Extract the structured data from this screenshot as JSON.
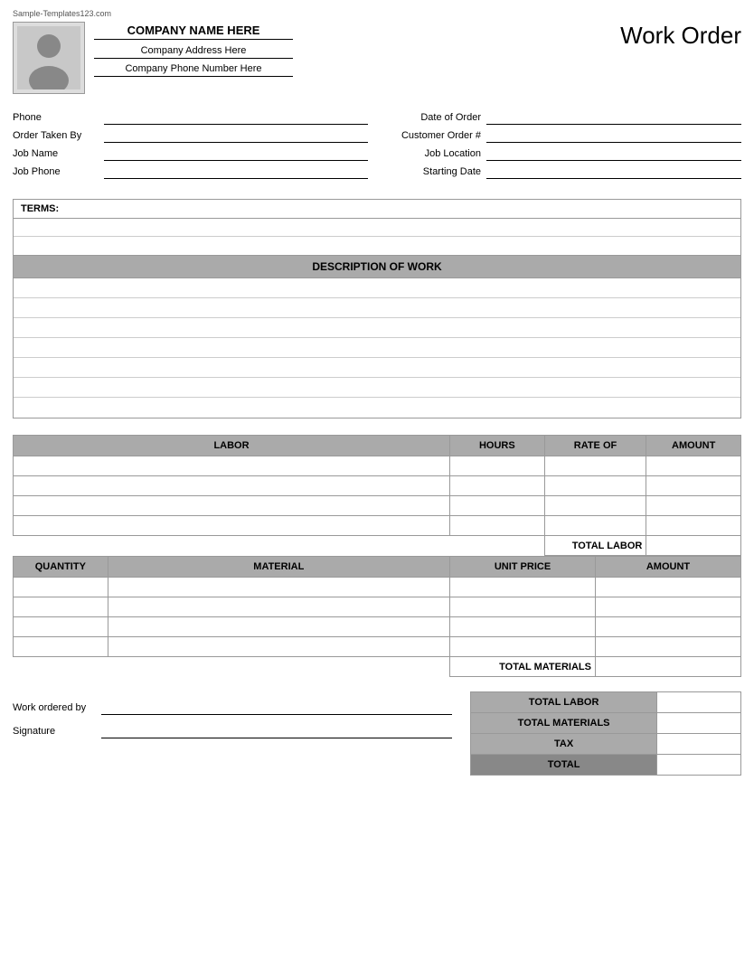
{
  "watermark": "Sample-Templates123.com",
  "header": {
    "company_name": "COMPANY NAME HERE",
    "company_address": "Company Address Here",
    "company_phone": "Company Phone Number Here",
    "title": "Work Order"
  },
  "form": {
    "left": [
      {
        "label": "Phone",
        "key": "phone"
      },
      {
        "label": "Order Taken By",
        "key": "order_taken_by"
      },
      {
        "label": "Job Name",
        "key": "job_name"
      },
      {
        "label": "Job Phone",
        "key": "job_phone"
      }
    ],
    "right": [
      {
        "label": "Date of Order",
        "key": "date_of_order"
      },
      {
        "label": "Customer Order #",
        "key": "customer_order"
      },
      {
        "label": "Job Location",
        "key": "job_location"
      },
      {
        "label": "Starting Date",
        "key": "starting_date"
      }
    ]
  },
  "terms": {
    "header": "TERMS:",
    "rows": 3
  },
  "description": {
    "header": "DESCRIPTION OF WORK",
    "rows": 7
  },
  "labor": {
    "columns": [
      "LABOR",
      "HOURS",
      "RATE OF",
      "AMOUNT"
    ],
    "rows": 4,
    "total_label": "TOTAL LABOR"
  },
  "materials": {
    "columns": [
      "QUANTITY",
      "MATERIAL",
      "UNIT PRICE",
      "AMOUNT"
    ],
    "rows": 4,
    "total_label": "TOTAL MATERIALS"
  },
  "bottom": {
    "work_ordered_by_label": "Work ordered by",
    "signature_label": "Signature",
    "totals": [
      {
        "label": "TOTAL LABOR",
        "bold": false
      },
      {
        "label": "TOTAL MATERIALS",
        "bold": false
      },
      {
        "label": "TAX",
        "bold": false
      },
      {
        "label": "TOTAL",
        "bold": true
      }
    ]
  }
}
